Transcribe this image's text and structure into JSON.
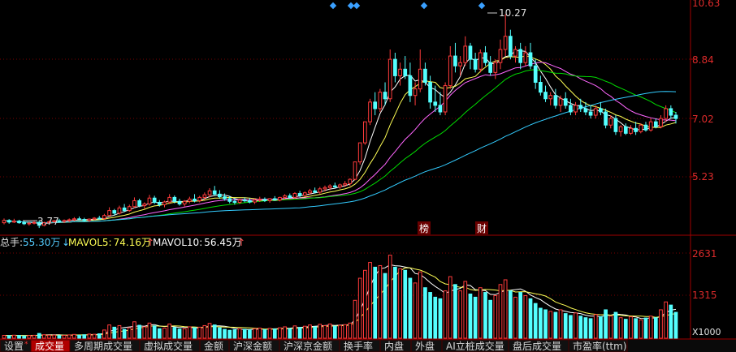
{
  "colors": {
    "up": "#ff3b3b",
    "down": "#54ffff",
    "ma_white": "#ffffff",
    "ma_yellow": "#ffff55",
    "ma_magenta": "#ff66ff",
    "ma_green": "#00dd00",
    "ma_cyan": "#33ccff",
    "grid": "#7a0000",
    "axis_text": "#dc2a2a",
    "marker": "#3aa0ff"
  },
  "price_axis": {
    "ticks": [
      "10.63",
      "8.84",
      "7.02",
      "5.23"
    ]
  },
  "price_annotations": {
    "high": "10.27",
    "low": "3.77"
  },
  "event_labels": [
    "榜",
    "财"
  ],
  "volume_header": {
    "total_label": "总手:",
    "total_value": "55.30万",
    "mavol5_label": "MAVOL5:",
    "mavol5_value": "74.16万",
    "mavol10_label": "MAVOL10:",
    "mavol10_value": "56.45万"
  },
  "volume_axis": {
    "ticks": [
      "2631",
      "1315"
    ],
    "unit": "X1000"
  },
  "tabs": [
    "设置",
    "成交量",
    "多周期成交量",
    "虚拟成交量",
    "金额",
    "沪深金额",
    "沪深京金额",
    "换手率",
    "内盘",
    "外盘",
    "AI立桩成交量",
    "盘后成交量",
    "市盈率(ttm)"
  ],
  "active_tab_index": 1,
  "chart_data": {
    "type": "candlestick_with_volume",
    "price_series": {
      "name": "",
      "ohlc_description": "daily candles, [open, high, low, close]",
      "candles": [
        [
          3.93,
          4.06,
          3.88,
          4.0
        ],
        [
          4.0,
          4.04,
          3.9,
          3.95
        ],
        [
          3.95,
          4.05,
          3.92,
          3.98
        ],
        [
          3.98,
          4.02,
          3.9,
          3.93
        ],
        [
          3.93,
          3.98,
          3.86,
          3.9
        ],
        [
          3.9,
          3.96,
          3.84,
          3.92
        ],
        [
          3.92,
          3.99,
          3.88,
          3.94
        ],
        [
          3.94,
          4.0,
          3.77,
          3.85
        ],
        [
          3.85,
          3.96,
          3.82,
          3.93
        ],
        [
          3.93,
          4.0,
          3.9,
          3.96
        ],
        [
          3.96,
          4.02,
          3.92,
          3.99
        ],
        [
          3.99,
          4.05,
          3.94,
          3.97
        ],
        [
          3.97,
          4.03,
          3.92,
          4.0
        ],
        [
          4.0,
          4.06,
          3.95,
          4.02
        ],
        [
          4.02,
          4.1,
          3.98,
          4.05
        ],
        [
          4.05,
          4.12,
          4.0,
          4.03
        ],
        [
          4.03,
          4.08,
          3.96,
          4.0
        ],
        [
          4.0,
          4.06,
          3.95,
          4.04
        ],
        [
          4.04,
          4.1,
          4.0,
          4.07
        ],
        [
          4.07,
          4.14,
          4.02,
          4.06
        ],
        [
          4.06,
          4.2,
          4.02,
          4.15
        ],
        [
          4.15,
          4.4,
          4.12,
          4.3
        ],
        [
          4.3,
          4.35,
          4.15,
          4.22
        ],
        [
          4.22,
          4.45,
          4.18,
          4.38
        ],
        [
          4.38,
          4.5,
          4.25,
          4.3
        ],
        [
          4.3,
          4.48,
          4.26,
          4.42
        ],
        [
          4.42,
          4.7,
          4.38,
          4.6
        ],
        [
          4.6,
          4.66,
          4.4,
          4.45
        ],
        [
          4.45,
          4.55,
          4.36,
          4.5
        ],
        [
          4.5,
          4.78,
          4.45,
          4.68
        ],
        [
          4.68,
          4.75,
          4.5,
          4.55
        ],
        [
          4.55,
          4.62,
          4.42,
          4.48
        ],
        [
          4.48,
          4.6,
          4.4,
          4.56
        ],
        [
          4.56,
          4.8,
          4.5,
          4.7
        ],
        [
          4.7,
          4.76,
          4.52,
          4.58
        ],
        [
          4.58,
          4.66,
          4.45,
          4.5
        ],
        [
          4.5,
          4.62,
          4.42,
          4.58
        ],
        [
          4.58,
          4.72,
          4.52,
          4.65
        ],
        [
          4.65,
          4.8,
          4.55,
          4.6
        ],
        [
          4.6,
          4.75,
          4.55,
          4.7
        ],
        [
          4.7,
          4.85,
          4.62,
          4.78
        ],
        [
          4.78,
          4.98,
          4.7,
          4.9
        ],
        [
          4.9,
          5.05,
          4.75,
          4.8
        ],
        [
          4.8,
          4.92,
          4.66,
          4.72
        ],
        [
          4.72,
          4.82,
          4.6,
          4.66
        ],
        [
          4.66,
          4.74,
          4.52,
          4.58
        ],
        [
          4.58,
          4.68,
          4.48,
          4.55
        ],
        [
          4.55,
          4.66,
          4.5,
          4.62
        ],
        [
          4.62,
          4.7,
          4.55,
          4.6
        ],
        [
          4.6,
          4.68,
          4.52,
          4.56
        ],
        [
          4.56,
          4.66,
          4.5,
          4.62
        ],
        [
          4.62,
          4.72,
          4.56,
          4.64
        ],
        [
          4.64,
          4.7,
          4.56,
          4.6
        ],
        [
          4.6,
          4.68,
          4.54,
          4.66
        ],
        [
          4.66,
          4.74,
          4.6,
          4.62
        ],
        [
          4.62,
          4.72,
          4.58,
          4.7
        ],
        [
          4.7,
          4.8,
          4.64,
          4.75
        ],
        [
          4.75,
          4.82,
          4.66,
          4.7
        ],
        [
          4.7,
          4.86,
          4.66,
          4.82
        ],
        [
          4.82,
          4.9,
          4.7,
          4.76
        ],
        [
          4.76,
          4.88,
          4.72,
          4.84
        ],
        [
          4.84,
          4.96,
          4.78,
          4.9
        ],
        [
          4.9,
          5.0,
          4.82,
          4.86
        ],
        [
          4.86,
          5.02,
          4.8,
          4.96
        ],
        [
          4.96,
          5.06,
          4.88,
          5.0
        ],
        [
          5.0,
          5.1,
          4.92,
          5.05
        ],
        [
          5.05,
          5.15,
          4.98,
          5.02
        ],
        [
          5.02,
          5.12,
          4.96,
          5.08
        ],
        [
          5.08,
          5.2,
          5.02,
          5.12
        ],
        [
          5.12,
          5.28,
          5.05,
          5.25
        ],
        [
          5.25,
          5.78,
          5.22,
          5.78
        ],
        [
          5.78,
          6.36,
          5.7,
          6.36
        ],
        [
          6.36,
          7.0,
          6.3,
          7.0
        ],
        [
          7.0,
          7.7,
          6.9,
          7.6
        ],
        [
          7.6,
          7.9,
          7.2,
          7.4
        ],
        [
          7.4,
          8.0,
          7.3,
          7.9
        ],
        [
          7.9,
          8.2,
          7.5,
          7.7
        ],
        [
          7.7,
          9.2,
          7.6,
          8.9
        ],
        [
          8.9,
          9.1,
          8.2,
          8.4
        ],
        [
          8.4,
          8.8,
          8.1,
          8.6
        ],
        [
          8.6,
          9.0,
          8.3,
          8.4
        ],
        [
          8.4,
          8.8,
          7.6,
          7.8
        ],
        [
          7.8,
          8.2,
          7.5,
          8.0
        ],
        [
          8.0,
          9.2,
          7.9,
          8.6
        ],
        [
          8.6,
          8.8,
          8.1,
          8.2
        ],
        [
          8.2,
          8.4,
          7.4,
          7.6
        ],
        [
          7.6,
          8.1,
          7.3,
          7.5
        ],
        [
          7.5,
          7.9,
          7.2,
          7.3
        ],
        [
          7.3,
          8.2,
          7.2,
          8.1
        ],
        [
          8.1,
          9.3,
          8.0,
          9.0
        ],
        [
          9.0,
          9.4,
          8.5,
          8.7
        ],
        [
          8.7,
          9.0,
          8.4,
          8.8
        ],
        [
          8.8,
          9.6,
          8.7,
          9.3
        ],
        [
          9.3,
          9.4,
          8.6,
          8.9
        ],
        [
          8.9,
          9.1,
          8.5,
          8.6
        ],
        [
          8.6,
          9.2,
          8.5,
          9.1
        ],
        [
          9.1,
          9.3,
          8.7,
          8.8
        ],
        [
          8.8,
          9.0,
          8.4,
          8.5
        ],
        [
          8.5,
          8.9,
          8.3,
          8.8
        ],
        [
          8.8,
          9.5,
          8.6,
          9.2
        ],
        [
          9.2,
          10.27,
          9.0,
          9.6
        ],
        [
          9.6,
          9.8,
          8.9,
          9.0
        ],
        [
          9.0,
          9.3,
          8.8,
          9.2
        ],
        [
          9.2,
          9.4,
          8.6,
          8.8
        ],
        [
          8.8,
          9.3,
          8.7,
          9.1
        ],
        [
          9.1,
          9.4,
          8.6,
          8.7
        ],
        [
          8.7,
          8.9,
          8.0,
          8.2
        ],
        [
          8.2,
          8.4,
          7.8,
          7.9
        ],
        [
          7.9,
          8.1,
          7.6,
          7.7
        ],
        [
          7.7,
          7.9,
          7.5,
          7.8
        ],
        [
          7.8,
          8.0,
          7.4,
          7.5
        ],
        [
          7.5,
          7.8,
          7.3,
          7.7
        ],
        [
          7.7,
          7.9,
          7.4,
          7.5
        ],
        [
          7.5,
          7.7,
          7.2,
          7.3
        ],
        [
          7.3,
          7.6,
          7.2,
          7.5
        ],
        [
          7.5,
          7.7,
          7.3,
          7.4
        ],
        [
          7.4,
          7.6,
          7.2,
          7.3
        ],
        [
          7.3,
          7.5,
          7.1,
          7.2
        ],
        [
          7.2,
          7.5,
          7.1,
          7.4
        ],
        [
          7.4,
          7.6,
          7.2,
          7.3
        ],
        [
          7.3,
          7.4,
          6.8,
          6.9
        ],
        [
          6.9,
          7.2,
          6.8,
          7.1
        ],
        [
          7.1,
          7.2,
          6.6,
          6.7
        ],
        [
          6.7,
          6.9,
          6.55,
          6.85
        ],
        [
          6.85,
          6.95,
          6.6,
          6.65
        ],
        [
          6.65,
          6.9,
          6.6,
          6.8
        ],
        [
          6.8,
          7.0,
          6.6,
          6.7
        ],
        [
          6.7,
          6.95,
          6.65,
          6.9
        ],
        [
          6.9,
          7.0,
          6.7,
          6.75
        ],
        [
          6.75,
          7.1,
          6.7,
          7.0
        ],
        [
          7.0,
          7.1,
          6.8,
          6.85
        ],
        [
          6.85,
          7.2,
          6.8,
          7.1
        ],
        [
          7.1,
          7.5,
          7.0,
          7.4
        ],
        [
          7.4,
          7.5,
          7.1,
          7.2
        ],
        [
          7.2,
          7.3,
          6.95,
          7.1
        ]
      ],
      "moving_averages": [
        "white",
        "yellow",
        "magenta",
        "green",
        "cyan"
      ],
      "ylim": [
        3.6,
        10.63
      ]
    },
    "volume_series": {
      "name": "总手",
      "unit": "X1000",
      "values_thousands": [
        90,
        80,
        95,
        85,
        70,
        88,
        92,
        150,
        110,
        95,
        100,
        85,
        90,
        105,
        120,
        95,
        110,
        130,
        125,
        140,
        260,
        420,
        350,
        400,
        280,
        330,
        520,
        410,
        360,
        480,
        390,
        300,
        320,
        450,
        340,
        290,
        300,
        360,
        330,
        350,
        400,
        470,
        420,
        330,
        280,
        250,
        270,
        300,
        280,
        260,
        300,
        320,
        270,
        310,
        290,
        330,
        360,
        300,
        390,
        340,
        380,
        420,
        360,
        440,
        400,
        450,
        380,
        410,
        430,
        480,
        1200,
        1900,
        2150,
        2400,
        2250,
        2300,
        2050,
        2631,
        2250,
        2200,
        2150,
        1900,
        1750,
        2100,
        1600,
        1450,
        1300,
        1250,
        1500,
        1950,
        1700,
        1500,
        1800,
        1400,
        1300,
        1600,
        1450,
        1200,
        1350,
        1700,
        1850,
        1500,
        1300,
        1450,
        1350,
        1250,
        1100,
        950,
        900,
        850,
        820,
        900,
        780,
        720,
        800,
        700,
        650,
        620,
        750,
        680,
        900,
        700,
        820,
        650,
        600,
        680,
        620,
        580,
        640,
        700,
        650,
        900,
        1150,
        1050,
        820
      ],
      "mavol_lines": [
        "MAVOL5",
        "MAVOL10"
      ],
      "ylim": [
        0,
        2800
      ]
    }
  }
}
